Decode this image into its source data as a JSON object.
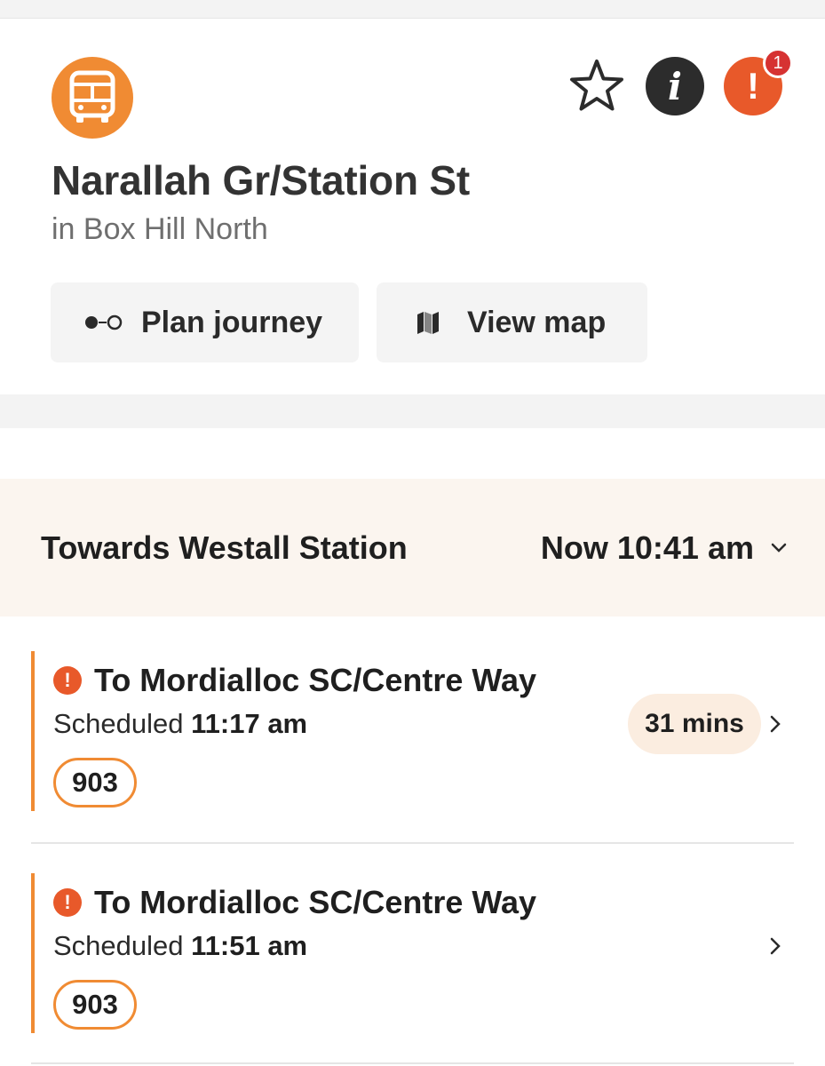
{
  "stop": {
    "name": "Narallah Gr/Station St",
    "locality": "in Box Hill North",
    "mode_icon": "bus-icon",
    "alert_count": "1"
  },
  "actions": {
    "favourite_icon": "star-icon",
    "info_symbol": "i",
    "alert_symbol": "!"
  },
  "buttons": {
    "plan": "Plan journey",
    "map": "View map"
  },
  "direction": {
    "label": "Towards Westall Station",
    "time": "Now 10:41 am"
  },
  "departures": [
    {
      "destination": "To Mordialloc SC/Centre Way",
      "scheduled_label": "Scheduled",
      "scheduled_time": "11:17 am",
      "eta": "31 mins",
      "route": "903"
    },
    {
      "destination": "To Mordialloc SC/Centre Way",
      "scheduled_label": "Scheduled",
      "scheduled_time": "11:51 am",
      "eta": "",
      "route": "903"
    }
  ],
  "colors": {
    "bus_orange": "#f08b33",
    "alert_red": "#e8592a",
    "badge_red": "#d63232",
    "direction_bg": "#fbf5ef",
    "eta_bg": "#fbede0"
  }
}
